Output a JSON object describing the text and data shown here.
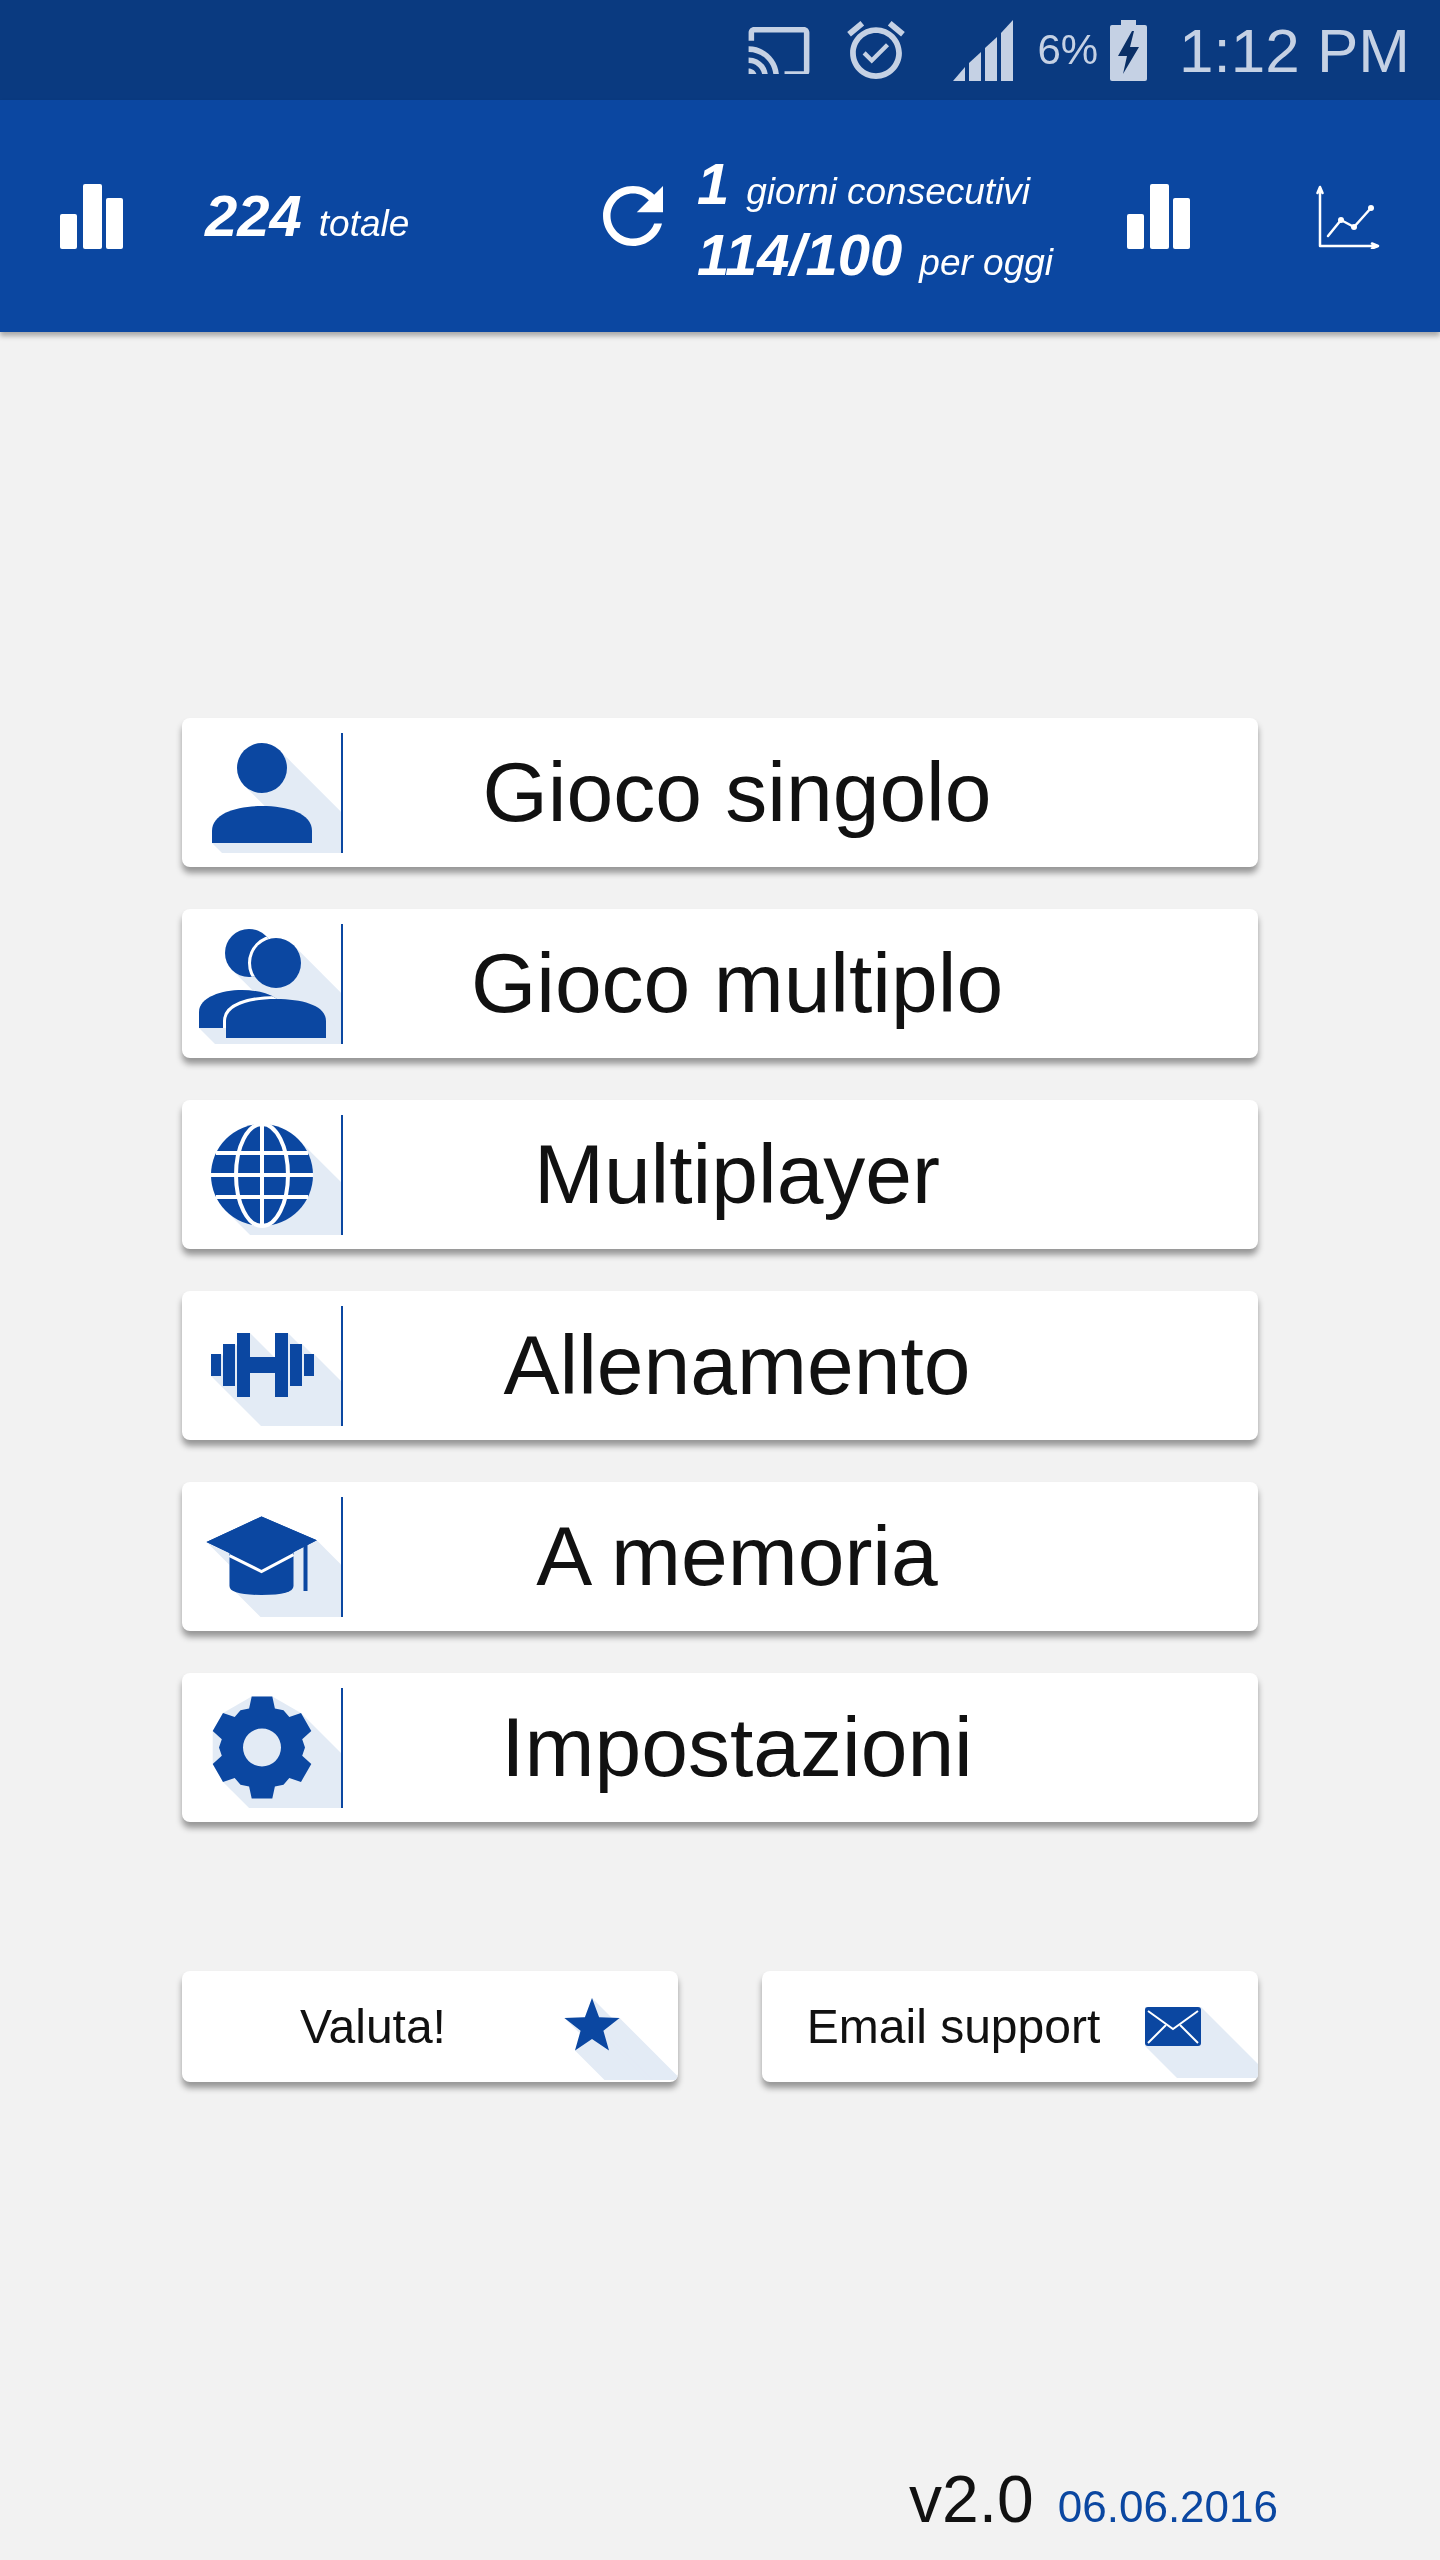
{
  "status_bar": {
    "battery": "6%",
    "time": "1:12 PM"
  },
  "header": {
    "total": {
      "value": "224",
      "label": "totale"
    },
    "streak": {
      "value": "1",
      "label": "giorni consecutivi"
    },
    "daily": {
      "value": "114/100",
      "label": "per oggi"
    }
  },
  "menu": [
    {
      "label": "Gioco singolo",
      "kind": "person"
    },
    {
      "label": "Gioco multiplo",
      "kind": "people"
    },
    {
      "label": "Multiplayer",
      "kind": "globe"
    },
    {
      "label": "Allenamento",
      "kind": "dumbbell"
    },
    {
      "label": "A memoria",
      "kind": "cap"
    },
    {
      "label": "Impostazioni",
      "kind": "gear"
    }
  ],
  "actions": [
    {
      "label": "Valuta!",
      "kind": "star"
    },
    {
      "label": "Email support",
      "kind": "envelope"
    }
  ],
  "footer": {
    "version": "v2.0",
    "date": "06.06.2016"
  }
}
